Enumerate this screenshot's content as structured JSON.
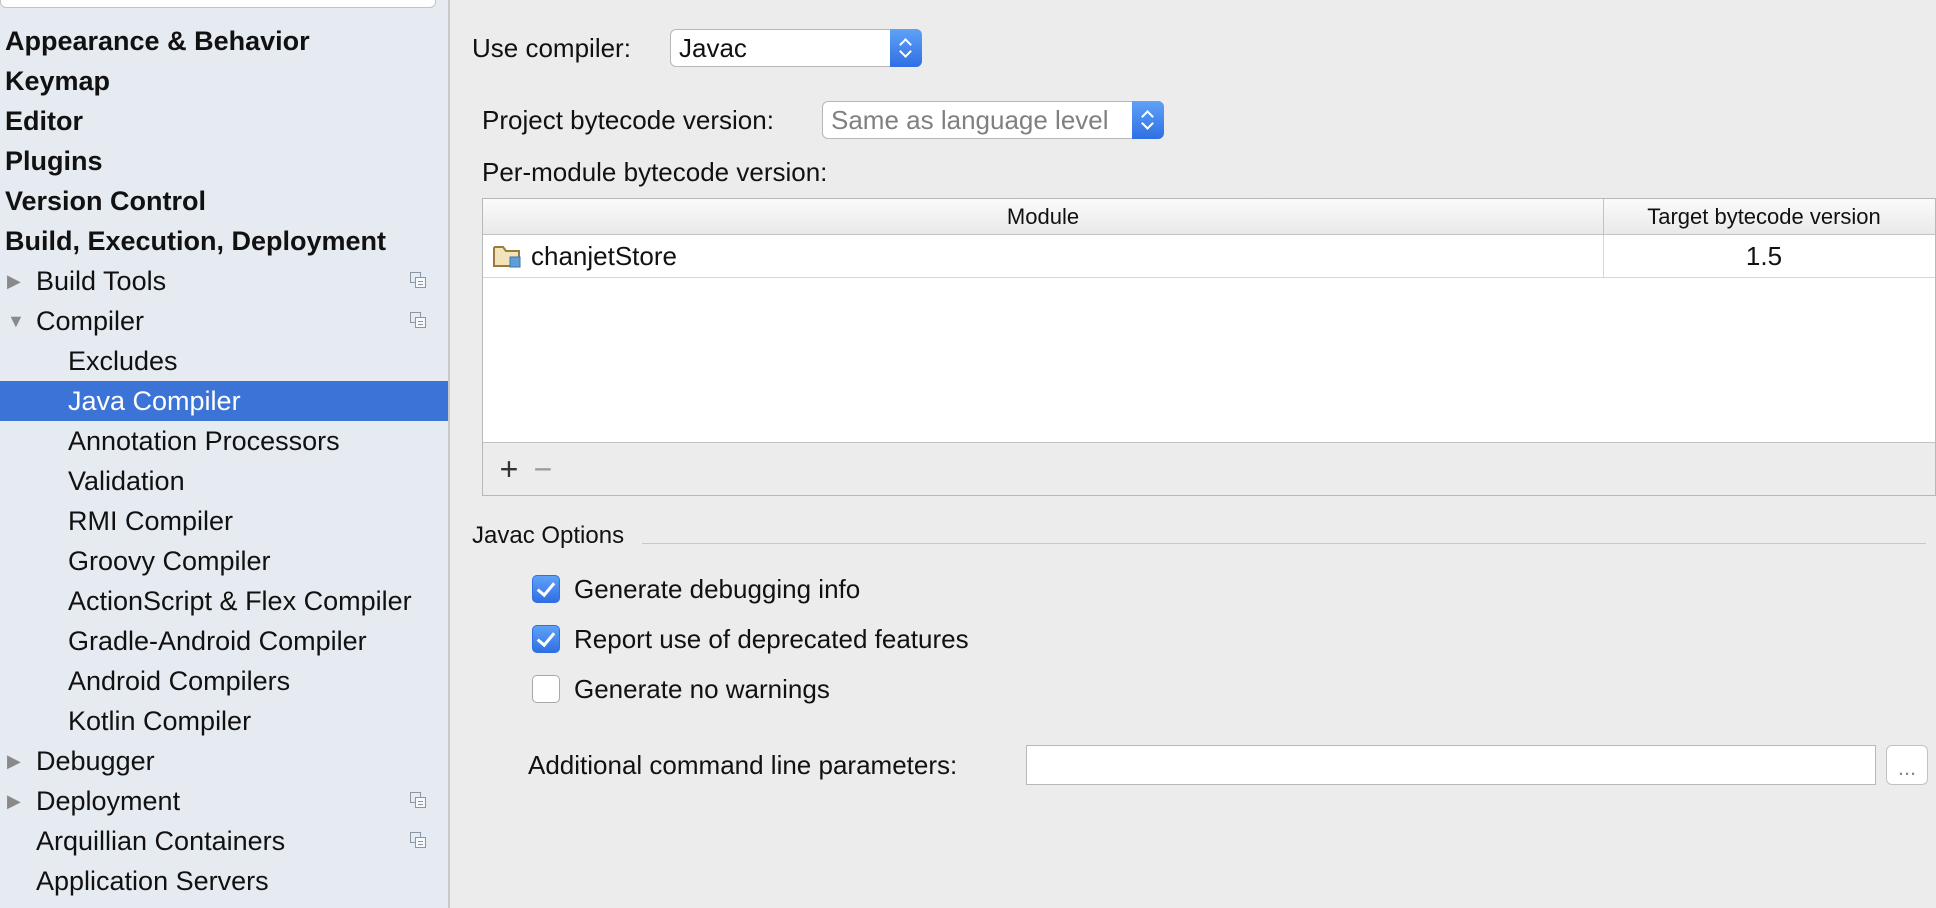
{
  "sidebar": {
    "items": [
      {
        "label": "Appearance & Behavior"
      },
      {
        "label": "Keymap"
      },
      {
        "label": "Editor"
      },
      {
        "label": "Plugins"
      },
      {
        "label": "Version Control"
      },
      {
        "label": "Build, Execution, Deployment"
      },
      {
        "label": "Build Tools"
      },
      {
        "label": "Compiler"
      },
      {
        "label": "Excludes"
      },
      {
        "label": "Java Compiler"
      },
      {
        "label": "Annotation Processors"
      },
      {
        "label": "Validation"
      },
      {
        "label": "RMI Compiler"
      },
      {
        "label": "Groovy Compiler"
      },
      {
        "label": "ActionScript & Flex Compiler"
      },
      {
        "label": "Gradle-Android Compiler"
      },
      {
        "label": "Android Compilers"
      },
      {
        "label": "Kotlin Compiler"
      },
      {
        "label": "Debugger"
      },
      {
        "label": "Deployment"
      },
      {
        "label": "Arquillian Containers"
      },
      {
        "label": "Application Servers"
      }
    ],
    "selected": "Java Compiler"
  },
  "main": {
    "use_compiler_label": "Use compiler:",
    "use_compiler_value": "Javac",
    "project_bytecode_label": "Project bytecode version:",
    "project_bytecode_value": "Same as language level",
    "per_module_label": "Per-module bytecode version:",
    "table": {
      "columns": [
        "Module",
        "Target bytecode version"
      ],
      "rows": [
        {
          "module": "chanjetStore",
          "target": "1.5"
        }
      ],
      "add_symbol": "+",
      "remove_symbol": "−"
    },
    "javac_options_title": "Javac Options",
    "options": [
      {
        "label": "Generate debugging info",
        "checked": true
      },
      {
        "label": "Report use of deprecated features",
        "checked": true
      },
      {
        "label": "Generate no warnings",
        "checked": false
      }
    ],
    "additional_params_label": "Additional command line parameters:",
    "additional_params_value": "",
    "browse_label": "..."
  },
  "colors": {
    "selection": "#3b73d6",
    "accent_blue": "#2f6fe4",
    "sidebar_bg": "#e6ebf1",
    "panel_bg": "#ececec"
  },
  "icons": {
    "expand_collapsed": "triangle-right-icon",
    "expand_expanded": "triangle-down-icon",
    "project_scope": "copy-icon",
    "module": "module-folder-icon"
  }
}
